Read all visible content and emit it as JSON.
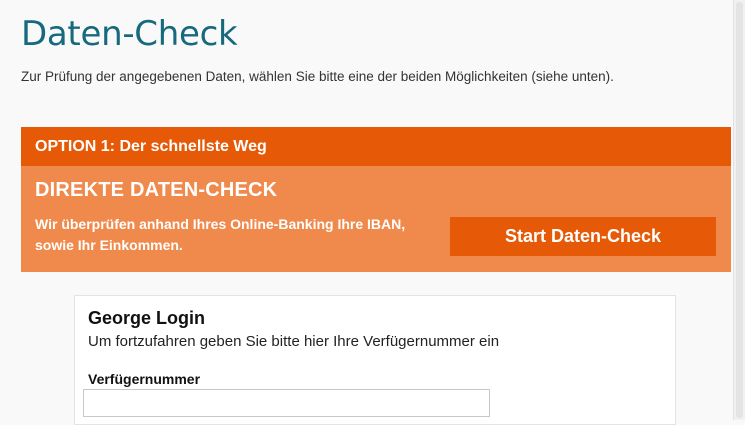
{
  "page": {
    "title": "Daten-Check",
    "intro": "Zur Prüfung der angegebenen Daten, wählen Sie bitte eine der beiden Möglichkeiten (siehe unten)."
  },
  "option1": {
    "header": "OPTION 1: Der schnellste Weg",
    "title": "DIREKTE DATEN-CHECK",
    "description": "Wir überprüfen anhand Ihres Online-Banking Ihre IBAN, sowie Ihr Einkommen.",
    "button_label": "Start Daten-Check"
  },
  "login": {
    "title": "George Login",
    "subtitle": "Um fortzufahren geben Sie bitte hier Ihre Verfügernummer ein",
    "field_label": "Verfügernummer",
    "field_value": ""
  },
  "colors": {
    "title": "#176a7e",
    "orange_dark": "#e65a07",
    "orange_light": "#f08a4c"
  }
}
